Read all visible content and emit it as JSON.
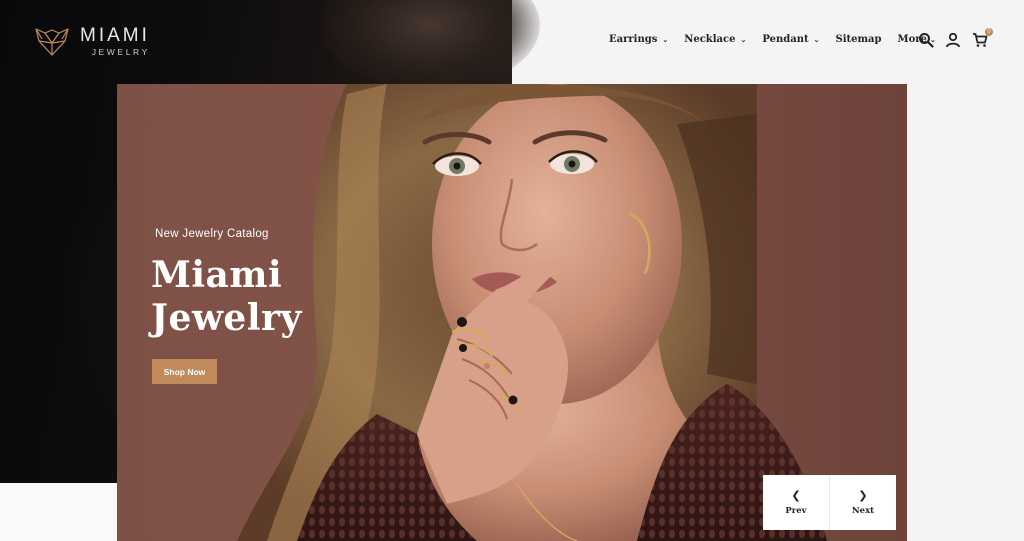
{
  "brand": {
    "name": "MIAMI",
    "tagline": "JEWELRY",
    "accent": "#c08a5b",
    "logo_icon": "fox-head-icon"
  },
  "nav": {
    "items": [
      {
        "label": "Earrings",
        "dropdown": true
      },
      {
        "label": "Necklace",
        "dropdown": true
      },
      {
        "label": "Pendant",
        "dropdown": true
      },
      {
        "label": "Sitemap",
        "dropdown": false
      },
      {
        "label": "More",
        "dropdown": true
      }
    ],
    "icons": [
      "search-icon",
      "user-icon",
      "cart-icon"
    ],
    "cart_count": "0"
  },
  "hero": {
    "eyebrow": "New Jewelry Catalog",
    "title_line1": "Miami",
    "title_line2": "Jewelry",
    "cta_label": "Shop Now",
    "background_color": "#7e5147"
  },
  "slider": {
    "prev_label": "Prev",
    "next_label": "Next",
    "prev_icon": "chevron-left-icon",
    "next_icon": "chevron-right-icon"
  }
}
